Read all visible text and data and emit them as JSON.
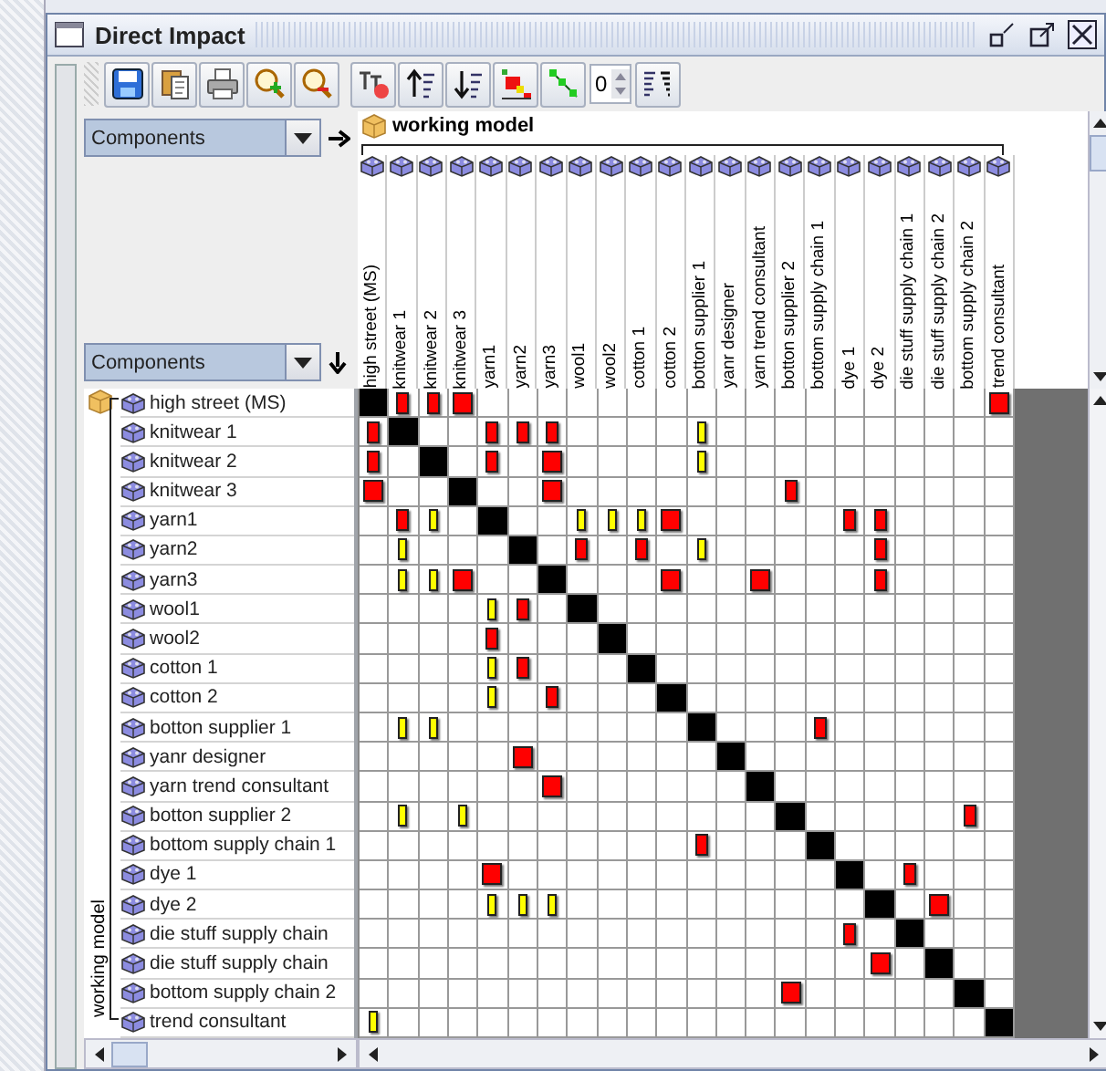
{
  "window": {
    "title": "Direct Impact"
  },
  "toolbar": {
    "spinner_value": "0"
  },
  "column_selector": {
    "value": "Components"
  },
  "row_selector": {
    "value": "Components"
  },
  "column_group": {
    "label": "working model"
  },
  "row_group": {
    "label": "working model"
  },
  "columns": [
    "high street (MS)",
    "knitwear 1",
    "knitwear 2",
    "knitwear 3",
    "yarn1",
    "yarn2",
    "yarn3",
    "wool1",
    "wool2",
    "cotton 1",
    "cotton 2",
    "botton supplier 1",
    "yanr designer",
    "yarn trend consultant",
    "botton supplier 2",
    "bottom supply chain 1",
    "dye 1",
    "dye 2",
    "die stuff supply chain 1",
    "die stuff supply chain 2",
    "bottom supply chain 2",
    "trend consultant"
  ],
  "rows": [
    {
      "label": "high street (MS)",
      "cells": [
        {
          "kind": "self"
        },
        {
          "kind": "medium"
        },
        {
          "kind": "medium"
        },
        {
          "kind": "strong"
        },
        {
          "kind": "none"
        },
        {
          "kind": "none"
        },
        {
          "kind": "none"
        },
        {
          "kind": "none"
        },
        {
          "kind": "none"
        },
        {
          "kind": "none"
        },
        {
          "kind": "none"
        },
        {
          "kind": "none"
        },
        {
          "kind": "none"
        },
        {
          "kind": "none"
        },
        {
          "kind": "none"
        },
        {
          "kind": "none"
        },
        {
          "kind": "none"
        },
        {
          "kind": "none"
        },
        {
          "kind": "none"
        },
        {
          "kind": "none"
        },
        {
          "kind": "none"
        },
        {
          "kind": "strong"
        }
      ]
    },
    {
      "label": "knitwear 1",
      "cells": [
        {
          "kind": "medium"
        },
        {
          "kind": "self"
        },
        {
          "kind": "none"
        },
        {
          "kind": "none"
        },
        {
          "kind": "medium"
        },
        {
          "kind": "medium"
        },
        {
          "kind": "medium"
        },
        {
          "kind": "none"
        },
        {
          "kind": "none"
        },
        {
          "kind": "none"
        },
        {
          "kind": "none"
        },
        {
          "kind": "weak"
        },
        {
          "kind": "none"
        },
        {
          "kind": "none"
        },
        {
          "kind": "none"
        },
        {
          "kind": "none"
        },
        {
          "kind": "none"
        },
        {
          "kind": "none"
        },
        {
          "kind": "none"
        },
        {
          "kind": "none"
        },
        {
          "kind": "none"
        },
        {
          "kind": "none"
        }
      ]
    },
    {
      "label": "knitwear 2",
      "cells": [
        {
          "kind": "medium"
        },
        {
          "kind": "none"
        },
        {
          "kind": "self"
        },
        {
          "kind": "none"
        },
        {
          "kind": "medium"
        },
        {
          "kind": "none"
        },
        {
          "kind": "strong"
        },
        {
          "kind": "none"
        },
        {
          "kind": "none"
        },
        {
          "kind": "none"
        },
        {
          "kind": "none"
        },
        {
          "kind": "weak"
        },
        {
          "kind": "none"
        },
        {
          "kind": "none"
        },
        {
          "kind": "none"
        },
        {
          "kind": "none"
        },
        {
          "kind": "none"
        },
        {
          "kind": "none"
        },
        {
          "kind": "none"
        },
        {
          "kind": "none"
        },
        {
          "kind": "none"
        },
        {
          "kind": "none"
        }
      ]
    },
    {
      "label": "knitwear 3",
      "cells": [
        {
          "kind": "strong"
        },
        {
          "kind": "none"
        },
        {
          "kind": "none"
        },
        {
          "kind": "self"
        },
        {
          "kind": "none"
        },
        {
          "kind": "none"
        },
        {
          "kind": "strong"
        },
        {
          "kind": "none"
        },
        {
          "kind": "none"
        },
        {
          "kind": "none"
        },
        {
          "kind": "none"
        },
        {
          "kind": "none"
        },
        {
          "kind": "none"
        },
        {
          "kind": "none"
        },
        {
          "kind": "medium"
        },
        {
          "kind": "none"
        },
        {
          "kind": "none"
        },
        {
          "kind": "none"
        },
        {
          "kind": "none"
        },
        {
          "kind": "none"
        },
        {
          "kind": "none"
        },
        {
          "kind": "none"
        }
      ]
    },
    {
      "label": "yarn1",
      "cells": [
        {
          "kind": "none"
        },
        {
          "kind": "medium"
        },
        {
          "kind": "weak"
        },
        {
          "kind": "none"
        },
        {
          "kind": "self"
        },
        {
          "kind": "none"
        },
        {
          "kind": "none"
        },
        {
          "kind": "weak"
        },
        {
          "kind": "weak"
        },
        {
          "kind": "weak"
        },
        {
          "kind": "strong"
        },
        {
          "kind": "none"
        },
        {
          "kind": "none"
        },
        {
          "kind": "none"
        },
        {
          "kind": "none"
        },
        {
          "kind": "none"
        },
        {
          "kind": "medium"
        },
        {
          "kind": "medium"
        },
        {
          "kind": "none"
        },
        {
          "kind": "none"
        },
        {
          "kind": "none"
        },
        {
          "kind": "none"
        }
      ]
    },
    {
      "label": "yarn2",
      "cells": [
        {
          "kind": "none"
        },
        {
          "kind": "weak"
        },
        {
          "kind": "none"
        },
        {
          "kind": "none"
        },
        {
          "kind": "none"
        },
        {
          "kind": "self"
        },
        {
          "kind": "none"
        },
        {
          "kind": "medium"
        },
        {
          "kind": "none"
        },
        {
          "kind": "medium"
        },
        {
          "kind": "none"
        },
        {
          "kind": "weak"
        },
        {
          "kind": "none"
        },
        {
          "kind": "none"
        },
        {
          "kind": "none"
        },
        {
          "kind": "none"
        },
        {
          "kind": "none"
        },
        {
          "kind": "medium"
        },
        {
          "kind": "none"
        },
        {
          "kind": "none"
        },
        {
          "kind": "none"
        },
        {
          "kind": "none"
        }
      ]
    },
    {
      "label": "yarn3",
      "cells": [
        {
          "kind": "none"
        },
        {
          "kind": "weak"
        },
        {
          "kind": "weak"
        },
        {
          "kind": "strong"
        },
        {
          "kind": "none"
        },
        {
          "kind": "none"
        },
        {
          "kind": "self"
        },
        {
          "kind": "none"
        },
        {
          "kind": "none"
        },
        {
          "kind": "none"
        },
        {
          "kind": "strong"
        },
        {
          "kind": "none"
        },
        {
          "kind": "none"
        },
        {
          "kind": "strong"
        },
        {
          "kind": "none"
        },
        {
          "kind": "none"
        },
        {
          "kind": "none"
        },
        {
          "kind": "medium"
        },
        {
          "kind": "none"
        },
        {
          "kind": "none"
        },
        {
          "kind": "none"
        },
        {
          "kind": "none"
        }
      ]
    },
    {
      "label": "wool1",
      "cells": [
        {
          "kind": "none"
        },
        {
          "kind": "none"
        },
        {
          "kind": "none"
        },
        {
          "kind": "none"
        },
        {
          "kind": "weak"
        },
        {
          "kind": "medium"
        },
        {
          "kind": "none"
        },
        {
          "kind": "self"
        },
        {
          "kind": "none"
        },
        {
          "kind": "none"
        },
        {
          "kind": "none"
        },
        {
          "kind": "none"
        },
        {
          "kind": "none"
        },
        {
          "kind": "none"
        },
        {
          "kind": "none"
        },
        {
          "kind": "none"
        },
        {
          "kind": "none"
        },
        {
          "kind": "none"
        },
        {
          "kind": "none"
        },
        {
          "kind": "none"
        },
        {
          "kind": "none"
        },
        {
          "kind": "none"
        }
      ]
    },
    {
      "label": "wool2",
      "cells": [
        {
          "kind": "none"
        },
        {
          "kind": "none"
        },
        {
          "kind": "none"
        },
        {
          "kind": "none"
        },
        {
          "kind": "medium"
        },
        {
          "kind": "none"
        },
        {
          "kind": "none"
        },
        {
          "kind": "none"
        },
        {
          "kind": "self"
        },
        {
          "kind": "none"
        },
        {
          "kind": "none"
        },
        {
          "kind": "none"
        },
        {
          "kind": "none"
        },
        {
          "kind": "none"
        },
        {
          "kind": "none"
        },
        {
          "kind": "none"
        },
        {
          "kind": "none"
        },
        {
          "kind": "none"
        },
        {
          "kind": "none"
        },
        {
          "kind": "none"
        },
        {
          "kind": "none"
        },
        {
          "kind": "none"
        }
      ]
    },
    {
      "label": "cotton 1",
      "cells": [
        {
          "kind": "none"
        },
        {
          "kind": "none"
        },
        {
          "kind": "none"
        },
        {
          "kind": "none"
        },
        {
          "kind": "weak"
        },
        {
          "kind": "medium"
        },
        {
          "kind": "none"
        },
        {
          "kind": "none"
        },
        {
          "kind": "none"
        },
        {
          "kind": "self"
        },
        {
          "kind": "none"
        },
        {
          "kind": "none"
        },
        {
          "kind": "none"
        },
        {
          "kind": "none"
        },
        {
          "kind": "none"
        },
        {
          "kind": "none"
        },
        {
          "kind": "none"
        },
        {
          "kind": "none"
        },
        {
          "kind": "none"
        },
        {
          "kind": "none"
        },
        {
          "kind": "none"
        },
        {
          "kind": "none"
        }
      ]
    },
    {
      "label": "cotton 2",
      "cells": [
        {
          "kind": "none"
        },
        {
          "kind": "none"
        },
        {
          "kind": "none"
        },
        {
          "kind": "none"
        },
        {
          "kind": "weak"
        },
        {
          "kind": "none"
        },
        {
          "kind": "medium"
        },
        {
          "kind": "none"
        },
        {
          "kind": "none"
        },
        {
          "kind": "none"
        },
        {
          "kind": "self"
        },
        {
          "kind": "none"
        },
        {
          "kind": "none"
        },
        {
          "kind": "none"
        },
        {
          "kind": "none"
        },
        {
          "kind": "none"
        },
        {
          "kind": "none"
        },
        {
          "kind": "none"
        },
        {
          "kind": "none"
        },
        {
          "kind": "none"
        },
        {
          "kind": "none"
        },
        {
          "kind": "none"
        }
      ]
    },
    {
      "label": "botton supplier 1",
      "cells": [
        {
          "kind": "none"
        },
        {
          "kind": "weak"
        },
        {
          "kind": "weak"
        },
        {
          "kind": "none"
        },
        {
          "kind": "none"
        },
        {
          "kind": "none"
        },
        {
          "kind": "none"
        },
        {
          "kind": "none"
        },
        {
          "kind": "none"
        },
        {
          "kind": "none"
        },
        {
          "kind": "none"
        },
        {
          "kind": "self"
        },
        {
          "kind": "none"
        },
        {
          "kind": "none"
        },
        {
          "kind": "none"
        },
        {
          "kind": "medium"
        },
        {
          "kind": "none"
        },
        {
          "kind": "none"
        },
        {
          "kind": "none"
        },
        {
          "kind": "none"
        },
        {
          "kind": "none"
        },
        {
          "kind": "none"
        }
      ]
    },
    {
      "label": "yanr designer",
      "cells": [
        {
          "kind": "none"
        },
        {
          "kind": "none"
        },
        {
          "kind": "none"
        },
        {
          "kind": "none"
        },
        {
          "kind": "none"
        },
        {
          "kind": "strong"
        },
        {
          "kind": "none"
        },
        {
          "kind": "none"
        },
        {
          "kind": "none"
        },
        {
          "kind": "none"
        },
        {
          "kind": "none"
        },
        {
          "kind": "none"
        },
        {
          "kind": "self"
        },
        {
          "kind": "none"
        },
        {
          "kind": "none"
        },
        {
          "kind": "none"
        },
        {
          "kind": "none"
        },
        {
          "kind": "none"
        },
        {
          "kind": "none"
        },
        {
          "kind": "none"
        },
        {
          "kind": "none"
        },
        {
          "kind": "none"
        }
      ]
    },
    {
      "label": "yarn trend consultant",
      "cells": [
        {
          "kind": "none"
        },
        {
          "kind": "none"
        },
        {
          "kind": "none"
        },
        {
          "kind": "none"
        },
        {
          "kind": "none"
        },
        {
          "kind": "none"
        },
        {
          "kind": "strong"
        },
        {
          "kind": "none"
        },
        {
          "kind": "none"
        },
        {
          "kind": "none"
        },
        {
          "kind": "none"
        },
        {
          "kind": "none"
        },
        {
          "kind": "none"
        },
        {
          "kind": "self"
        },
        {
          "kind": "none"
        },
        {
          "kind": "none"
        },
        {
          "kind": "none"
        },
        {
          "kind": "none"
        },
        {
          "kind": "none"
        },
        {
          "kind": "none"
        },
        {
          "kind": "none"
        },
        {
          "kind": "none"
        }
      ]
    },
    {
      "label": "botton supplier 2",
      "cells": [
        {
          "kind": "none"
        },
        {
          "kind": "weak"
        },
        {
          "kind": "none"
        },
        {
          "kind": "weak"
        },
        {
          "kind": "none"
        },
        {
          "kind": "none"
        },
        {
          "kind": "none"
        },
        {
          "kind": "none"
        },
        {
          "kind": "none"
        },
        {
          "kind": "none"
        },
        {
          "kind": "none"
        },
        {
          "kind": "none"
        },
        {
          "kind": "none"
        },
        {
          "kind": "none"
        },
        {
          "kind": "self"
        },
        {
          "kind": "none"
        },
        {
          "kind": "none"
        },
        {
          "kind": "none"
        },
        {
          "kind": "none"
        },
        {
          "kind": "none"
        },
        {
          "kind": "medium"
        },
        {
          "kind": "none"
        }
      ]
    },
    {
      "label": "bottom supply chain 1",
      "cells": [
        {
          "kind": "none"
        },
        {
          "kind": "none"
        },
        {
          "kind": "none"
        },
        {
          "kind": "none"
        },
        {
          "kind": "none"
        },
        {
          "kind": "none"
        },
        {
          "kind": "none"
        },
        {
          "kind": "none"
        },
        {
          "kind": "none"
        },
        {
          "kind": "none"
        },
        {
          "kind": "none"
        },
        {
          "kind": "medium"
        },
        {
          "kind": "none"
        },
        {
          "kind": "none"
        },
        {
          "kind": "none"
        },
        {
          "kind": "self"
        },
        {
          "kind": "none"
        },
        {
          "kind": "none"
        },
        {
          "kind": "none"
        },
        {
          "kind": "none"
        },
        {
          "kind": "none"
        },
        {
          "kind": "none"
        }
      ]
    },
    {
      "label": "dye 1",
      "cells": [
        {
          "kind": "none"
        },
        {
          "kind": "none"
        },
        {
          "kind": "none"
        },
        {
          "kind": "none"
        },
        {
          "kind": "strong"
        },
        {
          "kind": "none"
        },
        {
          "kind": "none"
        },
        {
          "kind": "none"
        },
        {
          "kind": "none"
        },
        {
          "kind": "none"
        },
        {
          "kind": "none"
        },
        {
          "kind": "none"
        },
        {
          "kind": "none"
        },
        {
          "kind": "none"
        },
        {
          "kind": "none"
        },
        {
          "kind": "none"
        },
        {
          "kind": "self"
        },
        {
          "kind": "none"
        },
        {
          "kind": "medium"
        },
        {
          "kind": "none"
        },
        {
          "kind": "none"
        },
        {
          "kind": "none"
        }
      ]
    },
    {
      "label": "dye 2",
      "cells": [
        {
          "kind": "none"
        },
        {
          "kind": "none"
        },
        {
          "kind": "none"
        },
        {
          "kind": "none"
        },
        {
          "kind": "weak"
        },
        {
          "kind": "weak"
        },
        {
          "kind": "weak"
        },
        {
          "kind": "none"
        },
        {
          "kind": "none"
        },
        {
          "kind": "none"
        },
        {
          "kind": "none"
        },
        {
          "kind": "none"
        },
        {
          "kind": "none"
        },
        {
          "kind": "none"
        },
        {
          "kind": "none"
        },
        {
          "kind": "none"
        },
        {
          "kind": "none"
        },
        {
          "kind": "self"
        },
        {
          "kind": "none"
        },
        {
          "kind": "strong"
        },
        {
          "kind": "none"
        },
        {
          "kind": "none"
        }
      ]
    },
    {
      "label": "die stuff supply chain",
      "cells": [
        {
          "kind": "none"
        },
        {
          "kind": "none"
        },
        {
          "kind": "none"
        },
        {
          "kind": "none"
        },
        {
          "kind": "none"
        },
        {
          "kind": "none"
        },
        {
          "kind": "none"
        },
        {
          "kind": "none"
        },
        {
          "kind": "none"
        },
        {
          "kind": "none"
        },
        {
          "kind": "none"
        },
        {
          "kind": "none"
        },
        {
          "kind": "none"
        },
        {
          "kind": "none"
        },
        {
          "kind": "none"
        },
        {
          "kind": "none"
        },
        {
          "kind": "medium"
        },
        {
          "kind": "none"
        },
        {
          "kind": "self"
        },
        {
          "kind": "none"
        },
        {
          "kind": "none"
        },
        {
          "kind": "none"
        }
      ]
    },
    {
      "label": "die stuff supply chain",
      "cells": [
        {
          "kind": "none"
        },
        {
          "kind": "none"
        },
        {
          "kind": "none"
        },
        {
          "kind": "none"
        },
        {
          "kind": "none"
        },
        {
          "kind": "none"
        },
        {
          "kind": "none"
        },
        {
          "kind": "none"
        },
        {
          "kind": "none"
        },
        {
          "kind": "none"
        },
        {
          "kind": "none"
        },
        {
          "kind": "none"
        },
        {
          "kind": "none"
        },
        {
          "kind": "none"
        },
        {
          "kind": "none"
        },
        {
          "kind": "none"
        },
        {
          "kind": "none"
        },
        {
          "kind": "strong"
        },
        {
          "kind": "none"
        },
        {
          "kind": "self"
        },
        {
          "kind": "none"
        },
        {
          "kind": "none"
        }
      ]
    },
    {
      "label": "bottom supply chain 2",
      "cells": [
        {
          "kind": "none"
        },
        {
          "kind": "none"
        },
        {
          "kind": "none"
        },
        {
          "kind": "none"
        },
        {
          "kind": "none"
        },
        {
          "kind": "none"
        },
        {
          "kind": "none"
        },
        {
          "kind": "none"
        },
        {
          "kind": "none"
        },
        {
          "kind": "none"
        },
        {
          "kind": "none"
        },
        {
          "kind": "none"
        },
        {
          "kind": "none"
        },
        {
          "kind": "none"
        },
        {
          "kind": "strong"
        },
        {
          "kind": "none"
        },
        {
          "kind": "none"
        },
        {
          "kind": "none"
        },
        {
          "kind": "none"
        },
        {
          "kind": "none"
        },
        {
          "kind": "self"
        },
        {
          "kind": "none"
        }
      ]
    },
    {
      "label": "trend consultant",
      "cells": [
        {
          "kind": "weak"
        },
        {
          "kind": "none"
        },
        {
          "kind": "none"
        },
        {
          "kind": "none"
        },
        {
          "kind": "none"
        },
        {
          "kind": "none"
        },
        {
          "kind": "none"
        },
        {
          "kind": "none"
        },
        {
          "kind": "none"
        },
        {
          "kind": "none"
        },
        {
          "kind": "none"
        },
        {
          "kind": "none"
        },
        {
          "kind": "none"
        },
        {
          "kind": "none"
        },
        {
          "kind": "none"
        },
        {
          "kind": "none"
        },
        {
          "kind": "none"
        },
        {
          "kind": "none"
        },
        {
          "kind": "none"
        },
        {
          "kind": "none"
        },
        {
          "kind": "none"
        },
        {
          "kind": "self"
        }
      ]
    }
  ]
}
